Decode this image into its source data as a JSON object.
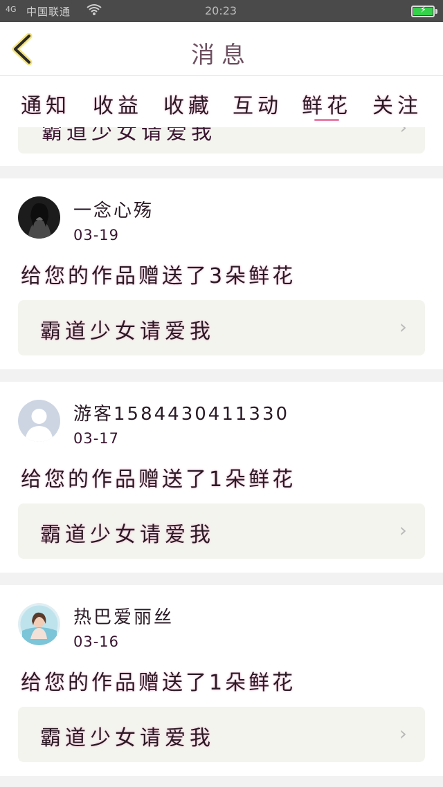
{
  "status_bar": {
    "signal": "4G",
    "carrier": "中国联通",
    "time": "20:23"
  },
  "header": {
    "title": "消息"
  },
  "tabs": [
    {
      "label": "通知"
    },
    {
      "label": "收益"
    },
    {
      "label": "收藏"
    },
    {
      "label": "互动"
    },
    {
      "label": "鲜花",
      "active": true
    },
    {
      "label": "关注"
    }
  ],
  "partial_item": {
    "work_title": "霸道少女请爱我"
  },
  "messages": [
    {
      "username": "一念心殇",
      "date": "03-19",
      "text": "给您的作品赠送了3朵鲜花",
      "work_title": "霸道少女请爱我",
      "avatar": "photo-avatar-dark"
    },
    {
      "username": "游客1584430411330",
      "date": "03-17",
      "text": "给您的作品赠送了1朵鲜花",
      "work_title": "霸道少女请爱我",
      "avatar": "default-user-avatar"
    },
    {
      "username": "热巴爱丽丝",
      "date": "03-16",
      "text": "给您的作品赠送了1朵鲜花",
      "work_title": "霸道少女请爱我",
      "avatar": "photo-avatar-beach"
    }
  ],
  "colors": {
    "accent": "#e97fa8",
    "work_box_bg": "#f4f4ef",
    "status_bar_bg": "#4a4a4a"
  }
}
